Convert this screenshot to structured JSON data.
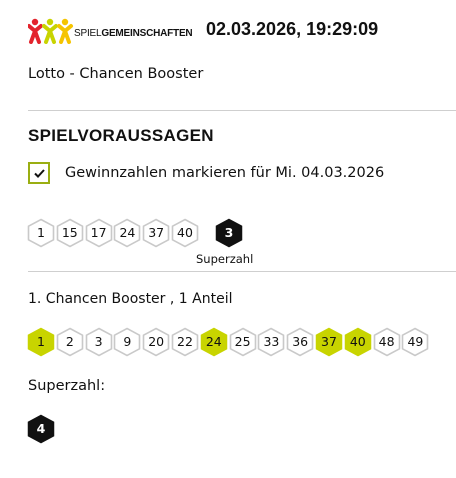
{
  "header": {
    "logo_text_prefix": "SPIEL",
    "logo_text_suffix": "GEMEINSCHAFTEN",
    "datetime": "02.03.2026, 19:29:09",
    "logo_colors": [
      "#e3232c",
      "#c8d400",
      "#f5c400"
    ]
  },
  "product_name": "Lotto - Chancen Booster",
  "predictions": {
    "section_title": "SPIELVORAUSSAGEN",
    "checkbox_label": "Gewinnzahlen markieren für Mi. 04.03.2026",
    "checkbox_checked": true,
    "numbers": [
      "1",
      "15",
      "17",
      "24",
      "37",
      "40"
    ],
    "superzahl": "3",
    "superzahl_caption": "Superzahl"
  },
  "tip": {
    "title": "1. Chancen Booster , 1 Anteil",
    "numbers": [
      {
        "value": "1",
        "hit": true
      },
      {
        "value": "2",
        "hit": false
      },
      {
        "value": "3",
        "hit": false
      },
      {
        "value": "9",
        "hit": false
      },
      {
        "value": "20",
        "hit": false
      },
      {
        "value": "22",
        "hit": false
      },
      {
        "value": "24",
        "hit": true
      },
      {
        "value": "25",
        "hit": false
      },
      {
        "value": "33",
        "hit": false
      },
      {
        "value": "36",
        "hit": false
      },
      {
        "value": "37",
        "hit": true
      },
      {
        "value": "40",
        "hit": true
      },
      {
        "value": "48",
        "hit": false
      },
      {
        "value": "49",
        "hit": false
      }
    ],
    "superzahl_label": "Superzahl:",
    "superzahl": "4"
  },
  "colors": {
    "hit_fill": "#c8d400",
    "checkbox_border": "#9aae12",
    "ring_stroke": "#c9c9c9",
    "dark_fill": "#111111"
  }
}
